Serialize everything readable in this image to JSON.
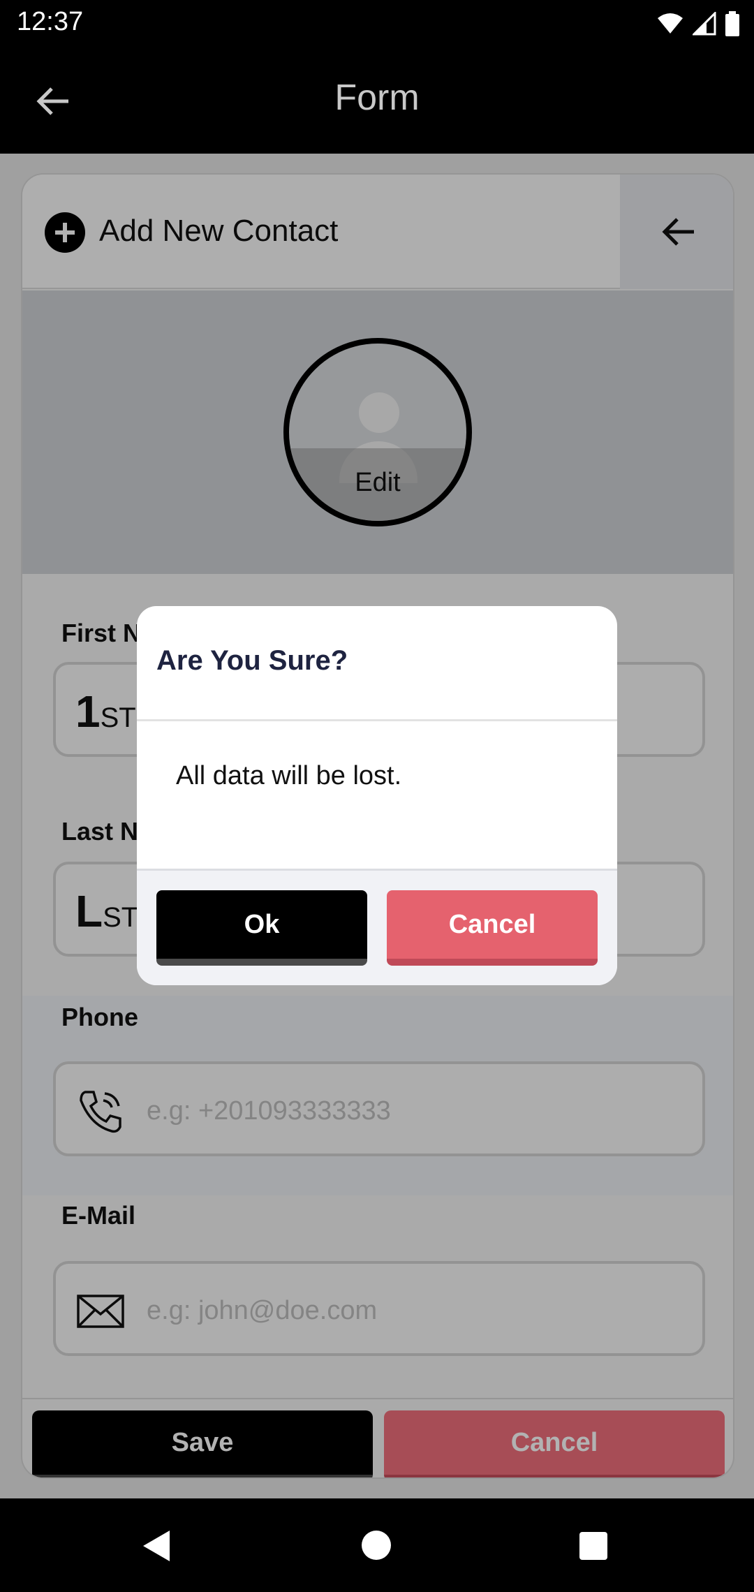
{
  "status_bar": {
    "time": "12:37",
    "icons": [
      "wifi-icon",
      "signal-icon",
      "battery-icon"
    ]
  },
  "app_bar": {
    "title": "Form",
    "back_icon": "arrow-left-icon"
  },
  "card": {
    "header": {
      "title": "Add New Contact",
      "add_icon": "plus-circle-icon",
      "back_icon": "arrow-left-icon"
    },
    "avatar": {
      "edit_label": "Edit"
    },
    "fields": {
      "first_name": {
        "label": "First Name",
        "prefix_big": "1",
        "prefix_small": "ST"
      },
      "last_name": {
        "label": "Last Name",
        "prefix_big": "L",
        "prefix_small": "ST"
      },
      "phone": {
        "label": "Phone",
        "placeholder": "e.g: +201093333333",
        "icon": "phone-icon"
      },
      "email": {
        "label": "E-Mail",
        "placeholder": "e.g: john@doe.com",
        "icon": "mail-icon"
      }
    },
    "footer": {
      "save_label": "Save",
      "cancel_label": "Cancel"
    }
  },
  "dialog": {
    "title": "Are You Sure?",
    "message": "All data will be lost.",
    "ok_label": "Ok",
    "cancel_label": "Cancel"
  },
  "colors": {
    "accent_black": "#000000",
    "cancel_red": "#e5626e",
    "title_navy": "#1e2340"
  }
}
